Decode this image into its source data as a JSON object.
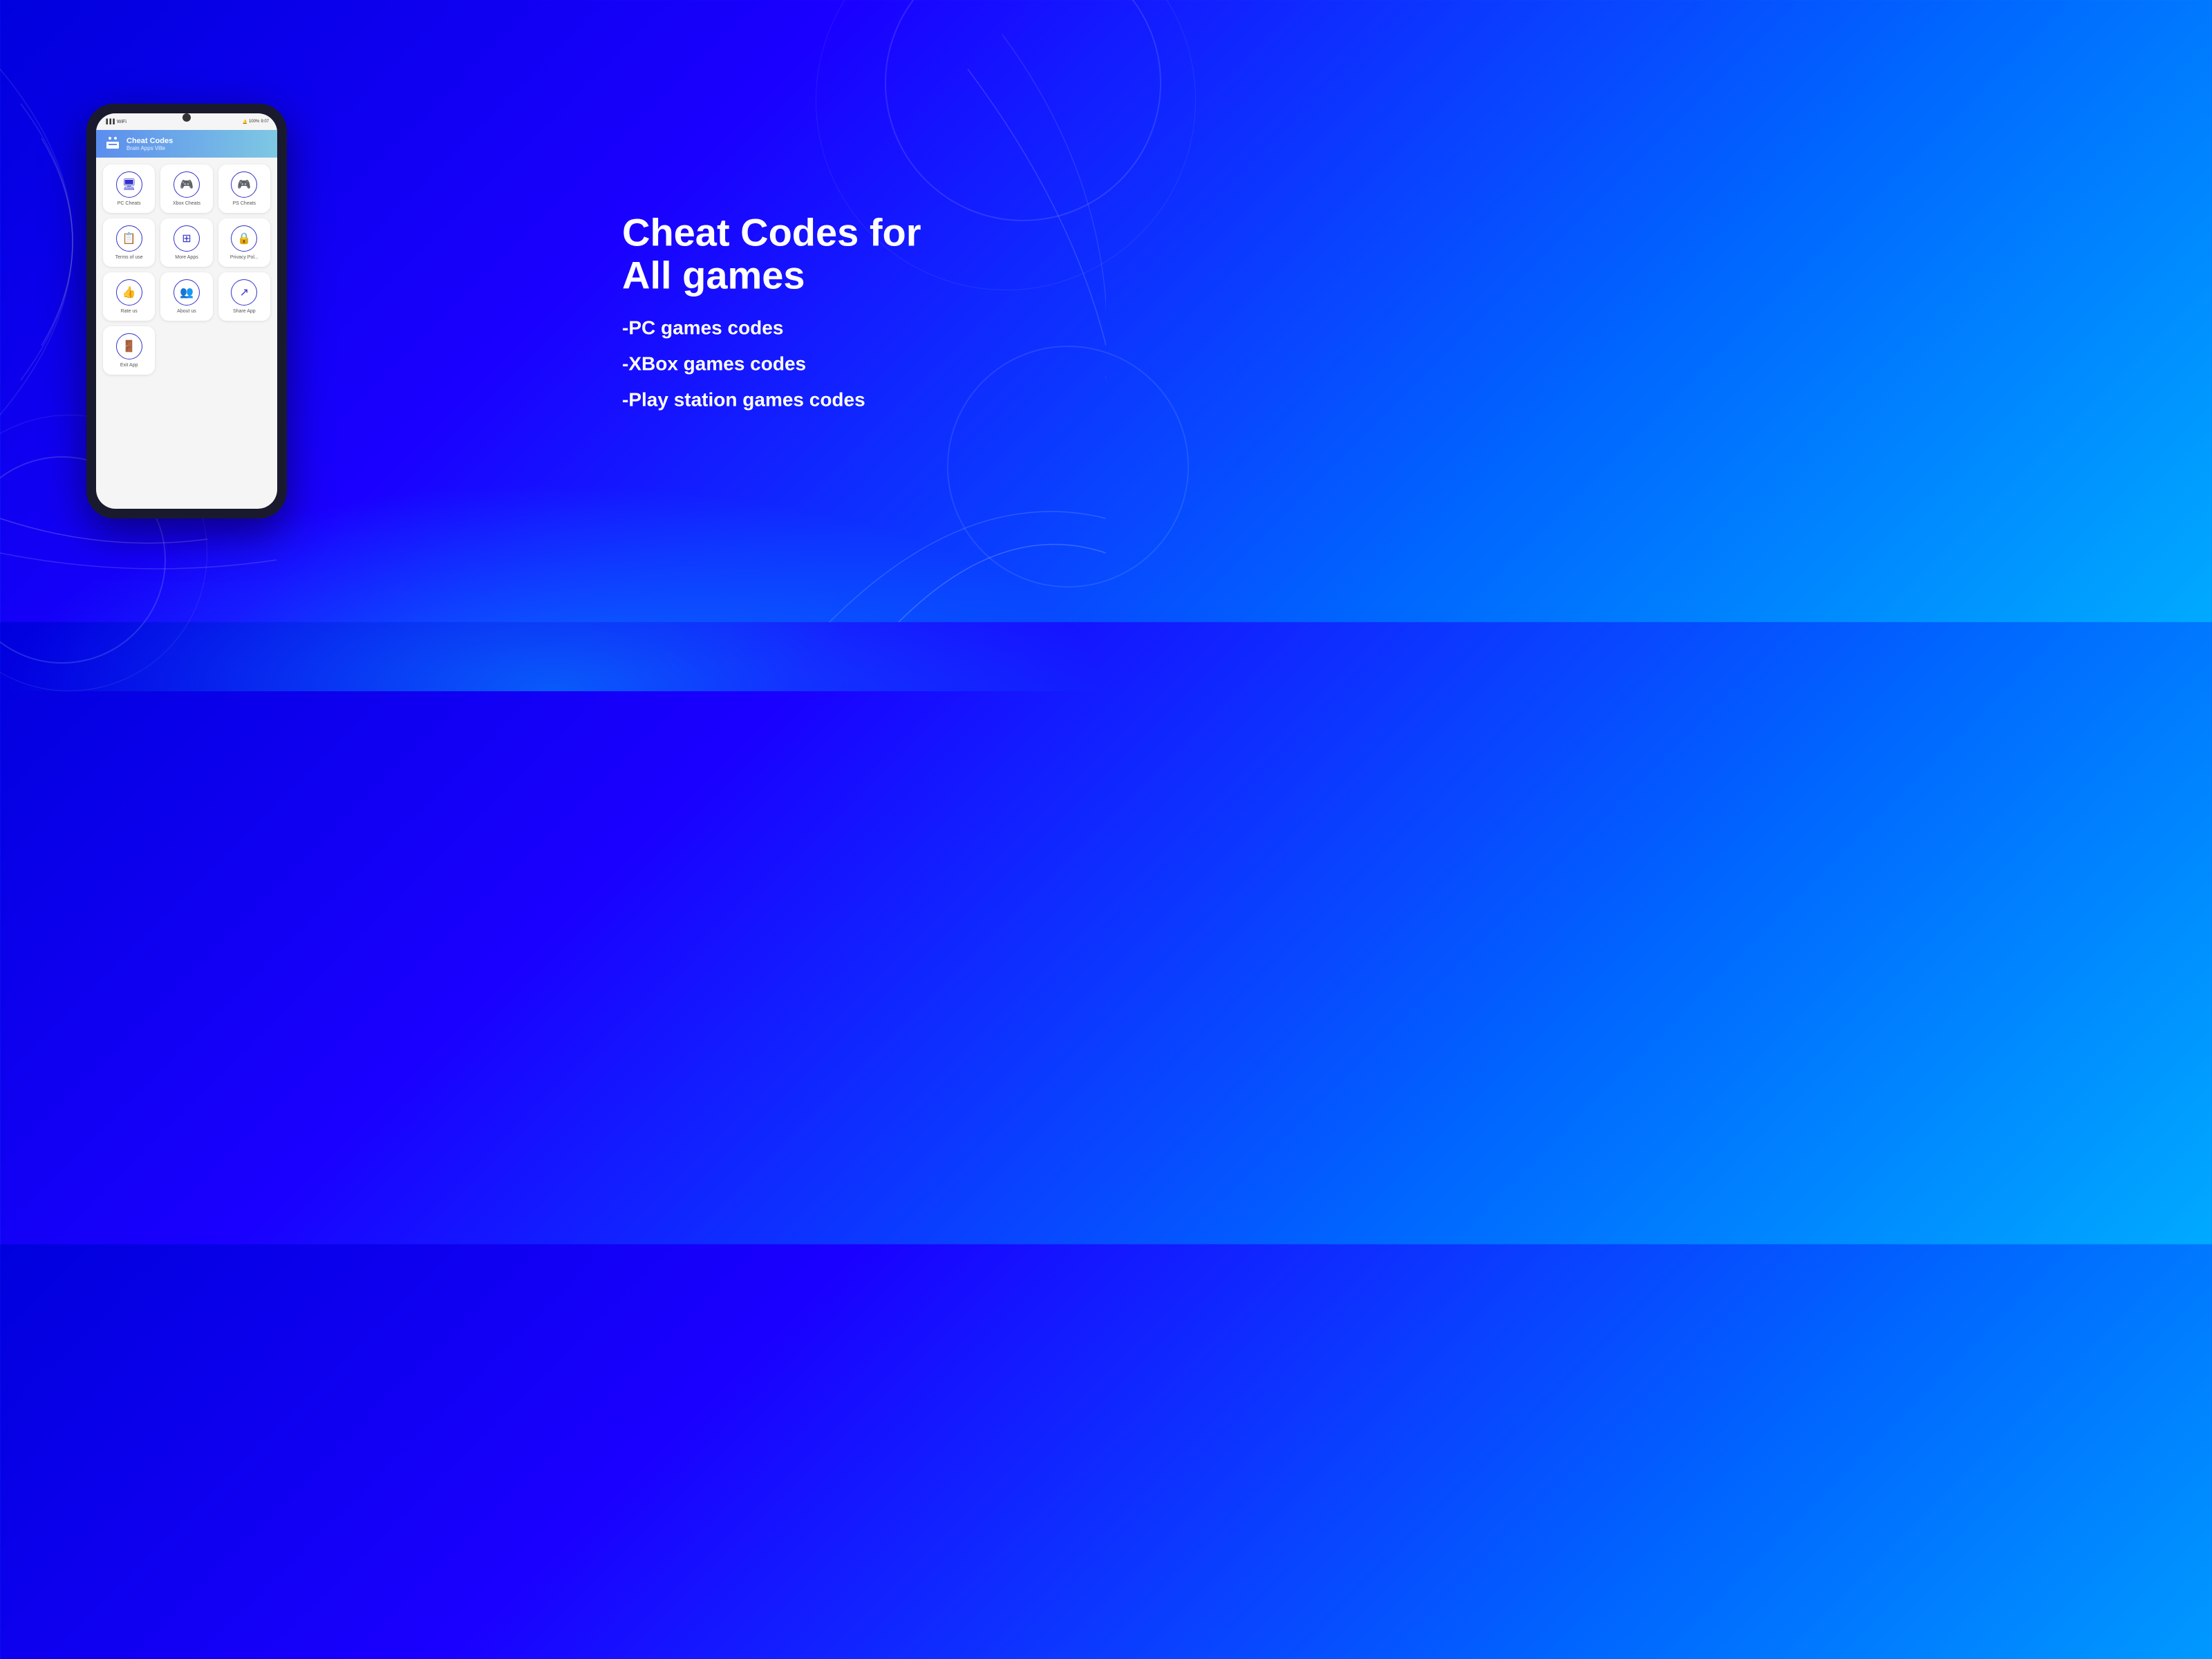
{
  "background": {
    "gradient_start": "#0000cc",
    "gradient_end": "#00aaff"
  },
  "phone": {
    "header": {
      "title": "Cheat Codes",
      "subtitle": "Brain Apps Ville"
    },
    "status_bar": {
      "signal": "▐▐▐",
      "wifi": "WiFi",
      "battery": "100%",
      "time": "9:07"
    },
    "menu_items": [
      {
        "label": "PC Cheats",
        "icon": "🖥"
      },
      {
        "label": "Xbox Cheats",
        "icon": "🎮"
      },
      {
        "label": "PS Cheats",
        "icon": "🎮"
      },
      {
        "label": "Terms of use",
        "icon": "📄"
      },
      {
        "label": "More Apps",
        "icon": "⊞"
      },
      {
        "label": "Privacy Pol...",
        "icon": "🔒"
      },
      {
        "label": "Rate us",
        "icon": "★"
      },
      {
        "label": "About us",
        "icon": "👤"
      },
      {
        "label": "Share App",
        "icon": "🔗"
      },
      {
        "label": "Exit App",
        "icon": "🚪"
      }
    ]
  },
  "right_content": {
    "headline_line1": "Cheat Codes for",
    "headline_line2": "All games",
    "features": [
      "-PC games codes",
      "-XBox games codes",
      "-Play station games codes"
    ]
  }
}
